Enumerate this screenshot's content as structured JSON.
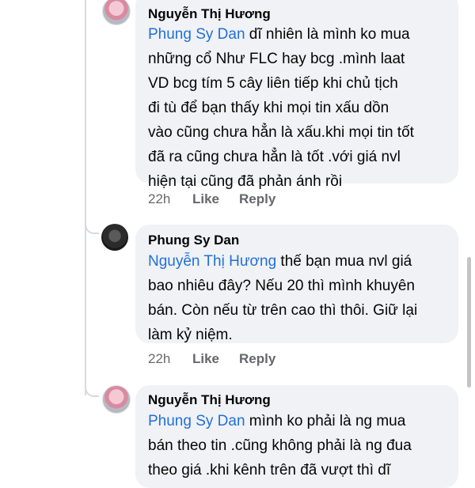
{
  "comments": [
    {
      "author": "Nguyễn Thị Hương",
      "mention": "Phung Sy Dan",
      "text": " dĩ nhiên là mình ko mua\nnhững cổ Như FLC hay bcg .mình laat\nVD bcg tím 5 cây liên tiếp khi chủ tịch\nđi tù để bạn thấy khi mọi tin xấu dồn\nvào cũng chưa hẳn là xấu.khi mọi tin tốt\nđã ra cũng chưa hẳn là tốt .với giá nvl\nhiện tại cũng đã phản ánh rồi",
      "time": "22h",
      "like": "Like",
      "reply": "Reply"
    },
    {
      "author": "Phung Sy Dan",
      "mention": "Nguyễn Thị Hương",
      "text": " thế bạn mua nvl giá\nbao nhiêu đây? Nếu 20 thì mình khuyên\nbán. Còn nếu từ trên cao thì thôi. Giữ lại\nlàm kỷ niệm.",
      "time": "22h",
      "like": "Like",
      "reply": "Reply"
    },
    {
      "author": "Nguyễn Thị Hương",
      "mention": "Phung Sy Dan",
      "text": " mình ko phải là ng mua\nbán theo tin .cũng không phải là ng đua\ntheo giá .khi kênh trên đã vượt thì dĩ"
    }
  ]
}
